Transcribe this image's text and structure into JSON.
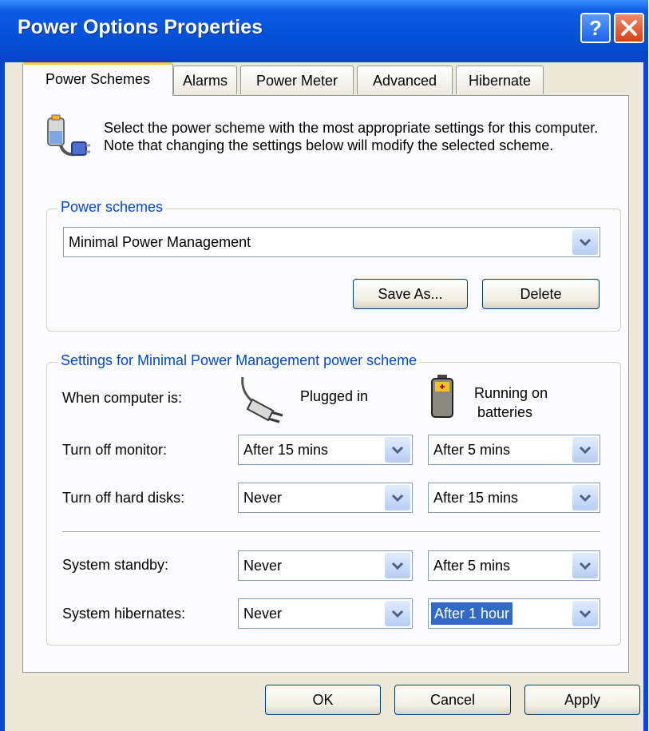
{
  "window": {
    "title": "Power Options Properties"
  },
  "tabs": [
    "Power Schemes",
    "Alarms",
    "Power Meter",
    "Advanced",
    "Hibernate"
  ],
  "intro_text": "Select the power scheme with the most appropriate settings for this computer. Note that changing the settings below will modify the selected scheme.",
  "power_schemes": {
    "legend": "Power schemes",
    "selected": "Minimal Power Management",
    "save_as_label": "Save As...",
    "delete_label": "Delete"
  },
  "settings": {
    "legend": "Settings for Minimal Power Management power scheme",
    "when_label": "When computer is:",
    "plugged_in_label": "Plugged in",
    "battery_label_line1": "Running on",
    "battery_label_line2": "batteries",
    "rows": [
      {
        "label": "Turn off monitor:",
        "plugged": "After 15 mins",
        "battery": "After 5 mins"
      },
      {
        "label": "Turn off hard disks:",
        "plugged": "Never",
        "battery": "After 15 mins"
      },
      {
        "label": "System standby:",
        "plugged": "Never",
        "battery": "After 5 mins"
      },
      {
        "label": "System hibernates:",
        "plugged": "Never",
        "battery": "After 1 hour"
      }
    ]
  },
  "buttons": {
    "ok": "OK",
    "cancel": "Cancel",
    "apply": "Apply"
  },
  "icons": [
    "help-icon",
    "close-icon",
    "power-options-icon",
    "power-plug-icon",
    "battery-icon",
    "chevron-down-icon"
  ],
  "colors": {
    "titlebar": "#0451d6",
    "legend_text": "#0046d5",
    "dialog_bg": "#ece9d8",
    "selection": "#316ac5",
    "tab_highlight": "#ffc83c"
  }
}
